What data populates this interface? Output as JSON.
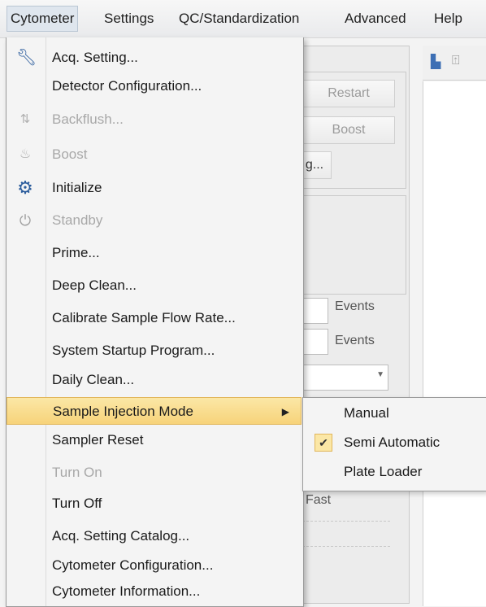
{
  "menubar": [
    "Cytometer",
    "Settings",
    "QC/Standardization",
    "Advanced",
    "Help"
  ],
  "background": {
    "restart": "Restart",
    "boost": "Boost",
    "truncated_button": "g...",
    "events1": "Events",
    "events2": "Events",
    "fast": "Fast"
  },
  "menu": {
    "items": [
      {
        "label": "Acq. Setting...",
        "icon": "wrench-icon",
        "disabled": false
      },
      {
        "label": "Detector Configuration...",
        "icon": "",
        "disabled": false
      },
      {
        "label": "Backflush...",
        "icon": "backflush-icon",
        "disabled": true
      },
      {
        "label": "Boost",
        "icon": "boost-icon",
        "disabled": true
      },
      {
        "label": "Initialize",
        "icon": "gear-icon",
        "disabled": false
      },
      {
        "label": "Standby",
        "icon": "power-icon",
        "disabled": true
      },
      {
        "label": "Prime...",
        "icon": "",
        "disabled": false
      },
      {
        "label": "Deep Clean...",
        "icon": "",
        "disabled": false
      },
      {
        "label": "Calibrate Sample Flow Rate...",
        "icon": "",
        "disabled": false
      },
      {
        "label": "System Startup Program...",
        "icon": "",
        "disabled": false
      },
      {
        "label": "Daily Clean...",
        "icon": "",
        "disabled": false
      },
      {
        "label": "Sample Injection Mode",
        "icon": "",
        "disabled": false,
        "highlighted": true
      },
      {
        "label": "Sampler Reset",
        "icon": "",
        "disabled": false
      },
      {
        "label": "Turn On",
        "icon": "",
        "disabled": true
      },
      {
        "label": "Turn Off",
        "icon": "",
        "disabled": false
      },
      {
        "label": "Acq. Setting Catalog...",
        "icon": "",
        "disabled": false
      },
      {
        "label": "Cytometer Configuration...",
        "icon": "",
        "disabled": false
      },
      {
        "label": "Cytometer Information...",
        "icon": "",
        "disabled": false
      }
    ]
  },
  "submenu": {
    "items": [
      {
        "label": "Manual",
        "checked": false
      },
      {
        "label": "Semi Automatic",
        "checked": true
      },
      {
        "label": "Plate Loader",
        "checked": false
      }
    ]
  },
  "colors": {
    "highlight": "#f7d37a",
    "highlight_border": "#e1b65a"
  }
}
